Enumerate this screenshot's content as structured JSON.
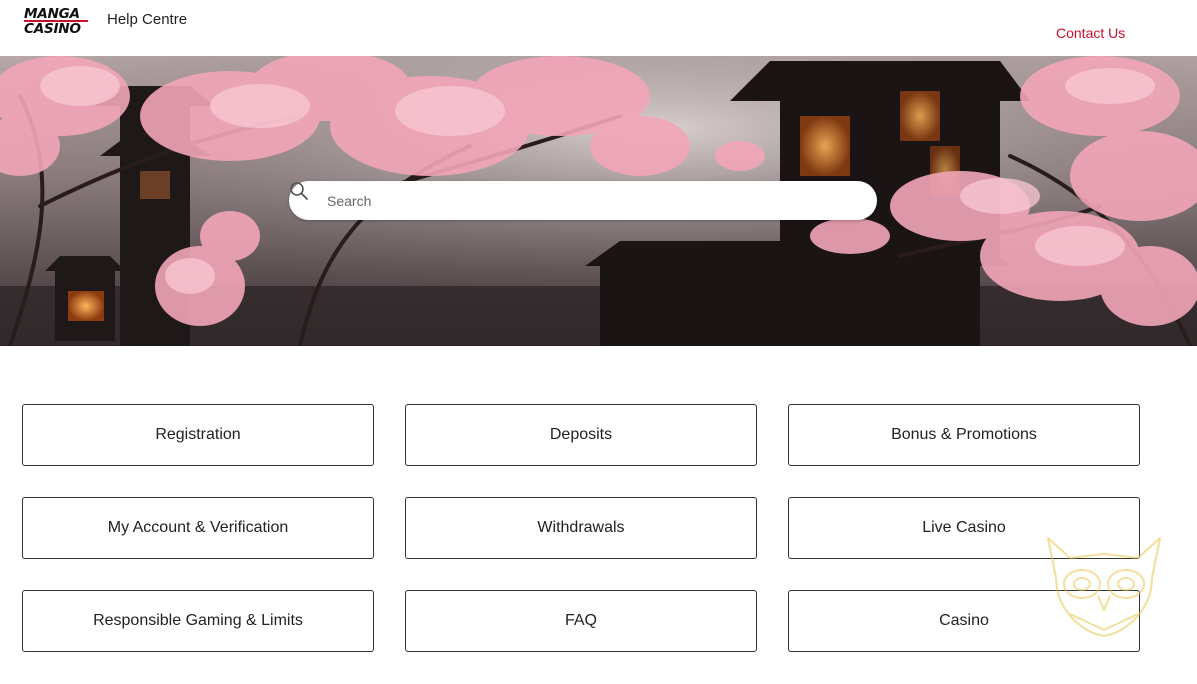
{
  "header": {
    "logo_line1": "MANGA",
    "logo_line2": "CASINO",
    "title": "Help Centre",
    "contact_label": "Contact Us"
  },
  "search": {
    "placeholder": "Search",
    "icon": "search-icon"
  },
  "categories": [
    {
      "label": "Registration"
    },
    {
      "label": "Deposits"
    },
    {
      "label": "Bonus & Promotions"
    },
    {
      "label": "My Account & Verification"
    },
    {
      "label": "Withdrawals"
    },
    {
      "label": "Live Casino"
    },
    {
      "label": "Responsible Gaming & Limits"
    },
    {
      "label": "FAQ"
    },
    {
      "label": "Casino"
    }
  ],
  "colors": {
    "accent": "#c8102e",
    "tile_border": "#333333",
    "blossom": "#f2a6b8"
  },
  "hero_image": "cherry-blossom-pagoda-banner"
}
